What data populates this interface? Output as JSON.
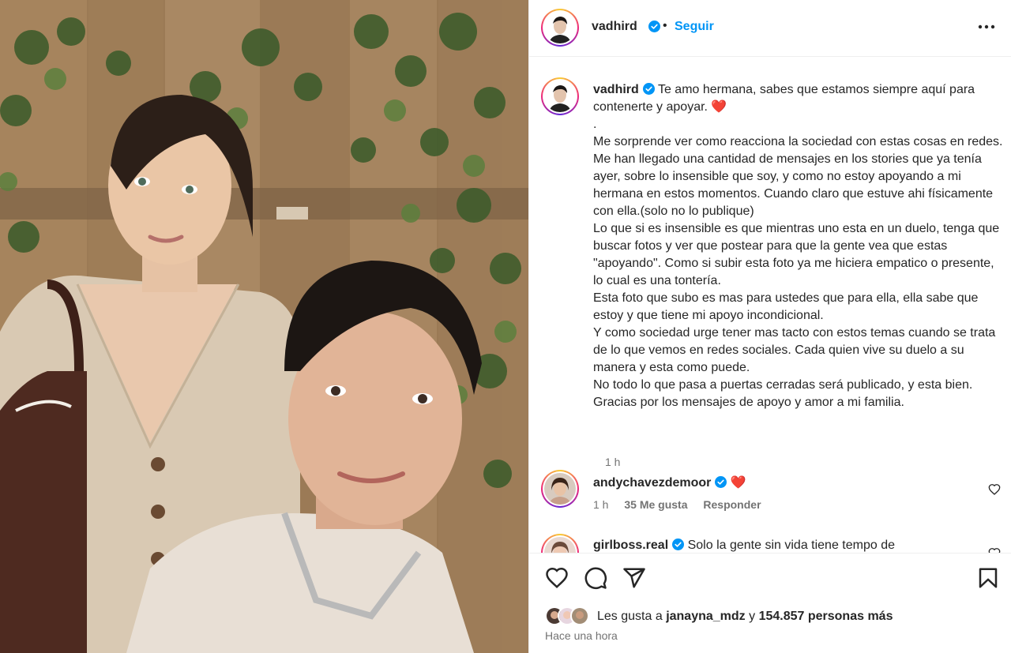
{
  "post": {
    "author": "vadhird",
    "follow_label": "Seguir",
    "separator": "•",
    "more_icon": "more-horizontal-icon"
  },
  "caption": {
    "username": "vadhird",
    "text": "Te amo hermana, sabes que estamos siempre aquí para contenerte y apoyar. ❤️\n.\nMe sorprende ver como reacciona la sociedad con estas cosas en redes. Me han llegado una cantidad de mensajes en los stories que ya tenía ayer, sobre lo insensible que soy, y como no estoy apoyando a mi hermana en estos momentos. Cuando claro que estuve ahi físicamente con ella.(solo no lo publique)\nLo que si es insensible es que mientras uno esta en un duelo, tenga que buscar fotos y ver que postear para que la gente vea que estas \"apoyando\". Como si subir esta foto ya me hiciera empatico o presente, lo cual es una tontería.\nEsta foto que subo es mas para ustedes que para ella, ella sabe que estoy y que tiene mi apoyo incondicional.\nY como sociedad urge tener mas tacto con estos temas cuando se trata de lo que vemos en redes sociales. Cada quien vive su duelo a su manera y esta como puede.\nNo todo lo que pasa a puertas cerradas será publicado, y esta bien.\nGracias por los mensajes de apoyo y amor a mi familia.",
    "time": "1 h"
  },
  "comments": [
    {
      "username": "andychavezdemoor",
      "text": "❤️",
      "time": "1 h",
      "likes": "35 Me gusta",
      "reply": "Responder"
    },
    {
      "username": "girlboss.real",
      "text": "Solo la gente sin vida tiene tempo de"
    }
  ],
  "actions": {
    "like_icon": "heart-icon",
    "comment_icon": "comment-icon",
    "share_icon": "share-icon",
    "save_icon": "bookmark-icon"
  },
  "likes": {
    "prefix": "Les gusta a",
    "user": "janayna_mdz",
    "conj": "y",
    "count": "154.857 personas más"
  },
  "posted": "Hace una hora",
  "colors": {
    "accent": "#0095f6",
    "verified": "#0095f6",
    "heart": "#ff3040",
    "muted": "#737373"
  }
}
